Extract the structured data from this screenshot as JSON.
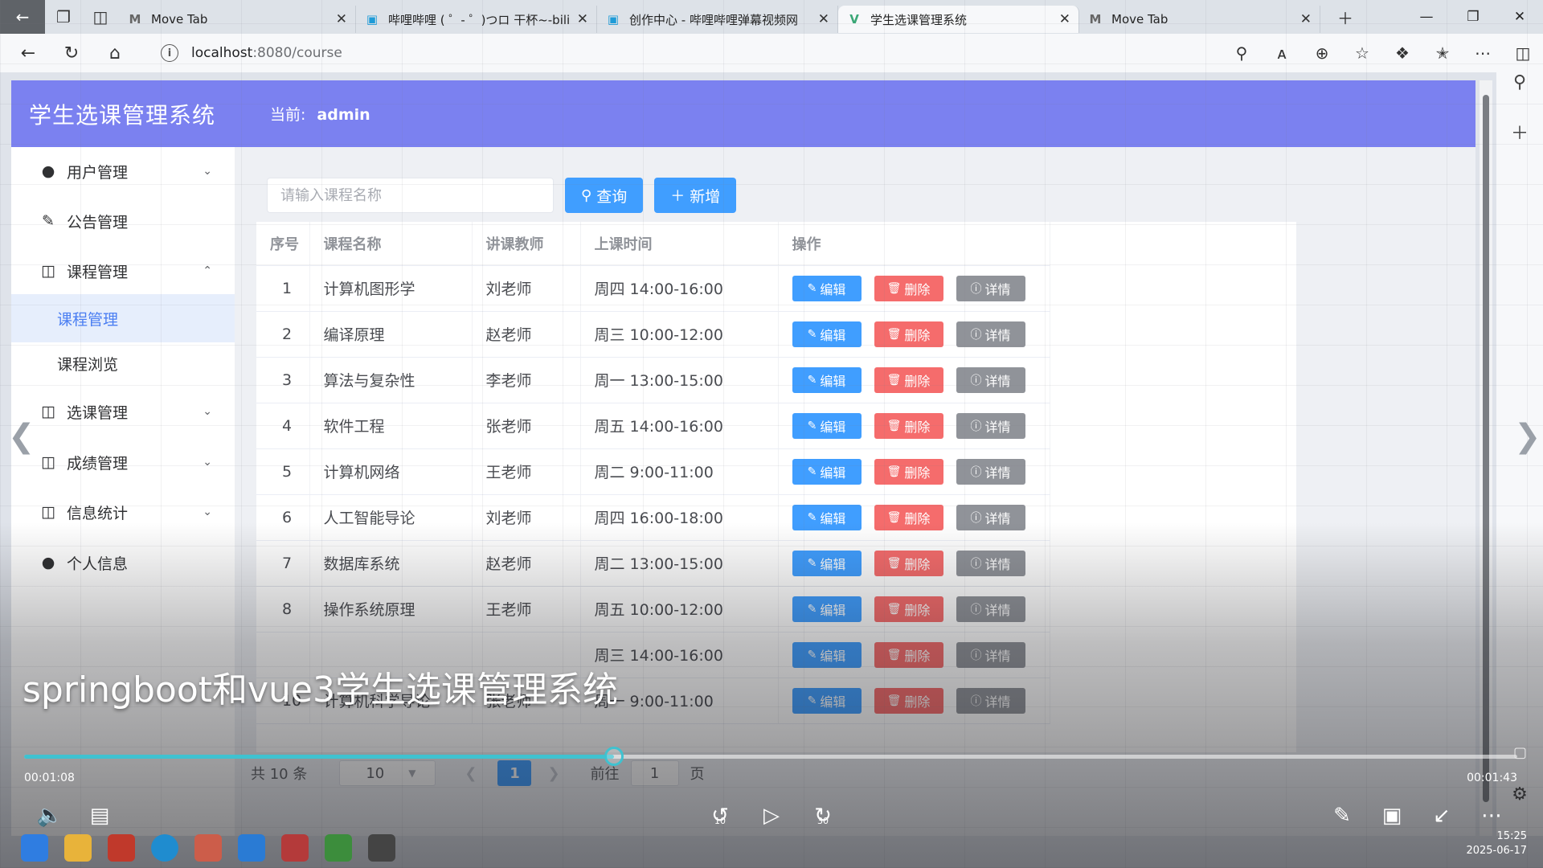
{
  "browser": {
    "tabs": [
      {
        "title": "Move Tab",
        "favicon": "M",
        "active": false
      },
      {
        "title": "哔哩哔哩 ( ゜- ゜)つロ 干杯~-bilibili",
        "favicon": "tv",
        "active": false
      },
      {
        "title": "创作中心 - 哔哩哔哩弹幕视频网",
        "favicon": "tv",
        "active": false
      },
      {
        "title": "学生选课管理系统",
        "favicon": "V",
        "active": true
      },
      {
        "title": "Move Tab",
        "favicon": "M",
        "active": false
      }
    ],
    "url_host": "localhost",
    "url_path": ":8080/course"
  },
  "header": {
    "title": "学生选课管理系统",
    "current_label": "当前:",
    "current_user": "admin"
  },
  "sidebar": {
    "items": [
      {
        "label": "用户管理",
        "icon": "user-icon",
        "expanded": false
      },
      {
        "label": "公告管理",
        "icon": "edit-icon"
      },
      {
        "label": "课程管理",
        "icon": "bag-icon",
        "expanded": true
      },
      {
        "label": "选课管理",
        "icon": "bag-icon",
        "expanded": false
      },
      {
        "label": "成绩管理",
        "icon": "bag-icon",
        "expanded": false
      },
      {
        "label": "信息统计",
        "icon": "bag-icon",
        "expanded": false
      },
      {
        "label": "个人信息",
        "icon": "user-icon"
      }
    ],
    "subitems": [
      {
        "label": "课程管理",
        "active": true
      },
      {
        "label": "课程浏览",
        "active": false
      }
    ]
  },
  "toolbar": {
    "search_placeholder": "请输入课程名称",
    "query_label": "查询",
    "add_label": "新增"
  },
  "table": {
    "columns": [
      "序号",
      "课程名称",
      "讲课教师",
      "上课时间",
      "操作"
    ],
    "rows": [
      {
        "id": "1",
        "name": "计算机图形学",
        "teacher": "刘老师",
        "time": "周四 14:00-16:00"
      },
      {
        "id": "2",
        "name": "编译原理",
        "teacher": "赵老师",
        "time": "周三 10:00-12:00"
      },
      {
        "id": "3",
        "name": "算法与复杂性",
        "teacher": "李老师",
        "time": "周一 13:00-15:00"
      },
      {
        "id": "4",
        "name": "软件工程",
        "teacher": "张老师",
        "time": "周五 14:00-16:00"
      },
      {
        "id": "5",
        "name": "计算机网络",
        "teacher": "王老师",
        "time": "周二 9:00-11:00"
      },
      {
        "id": "6",
        "name": "人工智能导论",
        "teacher": "刘老师",
        "time": "周四 16:00-18:00"
      },
      {
        "id": "7",
        "name": "数据库系统",
        "teacher": "赵老师",
        "time": "周二 13:00-15:00"
      },
      {
        "id": "8",
        "name": "操作系统原理",
        "teacher": "王老师",
        "time": "周五 10:00-12:00"
      },
      {
        "id": "",
        "name": "",
        "teacher": "",
        "time": "周三 14:00-16:00"
      },
      {
        "id": "10",
        "name": "计算机科学导论",
        "teacher": "张老师",
        "time": "周一 9:00-11:00"
      }
    ],
    "actions": {
      "edit": "编辑",
      "delete": "删除",
      "detail": "详情"
    }
  },
  "pagination": {
    "total": "共 10 条",
    "page_size": "10",
    "current_page": "1",
    "goto_label": "前往",
    "goto_value": "1",
    "page_suffix": "页"
  },
  "video": {
    "title": "springboot和vue3学生选课管理系统",
    "current_time": "00:01:08",
    "total_time": "00:01:43",
    "progress": 0.395,
    "accent": "#3fc2d0"
  },
  "taskbar": {
    "time": "15:25",
    "date": "2025-06-17"
  },
  "colors": {
    "header_bg": "#7b81f0",
    "primary": "#409eff",
    "danger": "#f56c6c",
    "info": "#909399"
  }
}
